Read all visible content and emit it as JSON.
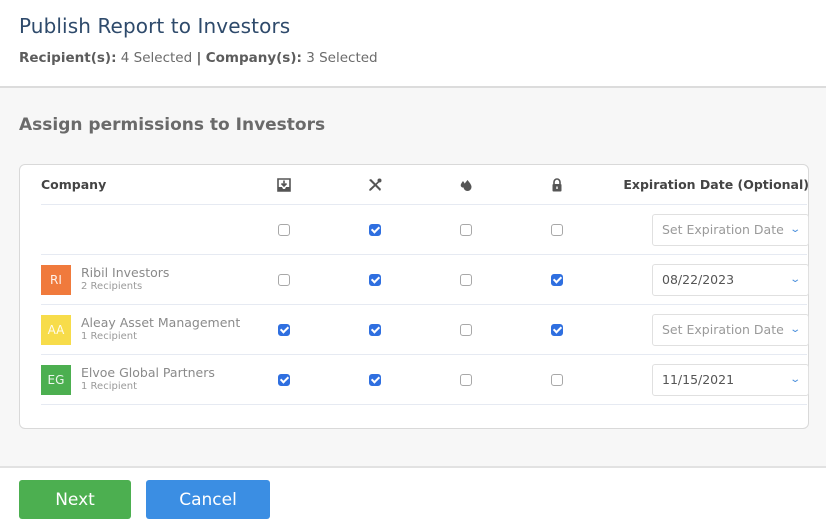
{
  "header": {
    "title": "Publish Report to Investors",
    "recipients_label": "Recipient(s):",
    "recipients_value": "4 Selected",
    "separator": "|",
    "companies_label": "Company(s):",
    "companies_value": "3 Selected"
  },
  "section": {
    "title": "Assign permissions to Investors"
  },
  "table": {
    "columns": {
      "company": "Company",
      "icons": [
        "download-tray-icon",
        "tools-icon",
        "drops-icon",
        "lock-icon"
      ],
      "expiration": "Expiration Date (Optional)"
    },
    "all_row": {
      "permissions": [
        false,
        true,
        false,
        false
      ],
      "expiration": "Set Expiration Date",
      "expiration_is_placeholder": true
    },
    "rows": [
      {
        "initials": "RI",
        "color": "#f07a3c",
        "name": "Ribil Investors",
        "recipients": "2 Recipients",
        "permissions": [
          false,
          true,
          false,
          true
        ],
        "expiration": "08/22/2023",
        "expiration_is_placeholder": false
      },
      {
        "initials": "AA",
        "color": "#f7dc4a",
        "name": "Aleay Asset Management",
        "recipients": "1 Recipient",
        "permissions": [
          true,
          true,
          false,
          true
        ],
        "expiration": "Set Expiration Date",
        "expiration_is_placeholder": true
      },
      {
        "initials": "EG",
        "color": "#4caf50",
        "name": "Elvoe Global Partners",
        "recipients": "1 Recipient",
        "permissions": [
          true,
          true,
          false,
          false
        ],
        "expiration": "11/15/2021",
        "expiration_is_placeholder": false
      }
    ]
  },
  "footer": {
    "next_label": "Next",
    "cancel_label": "Cancel"
  },
  "colors": {
    "title": "#2e4a6b",
    "checkbox_checked": "#2f6fe0",
    "next_button": "#4caf50",
    "cancel_button": "#3b8ee3"
  }
}
